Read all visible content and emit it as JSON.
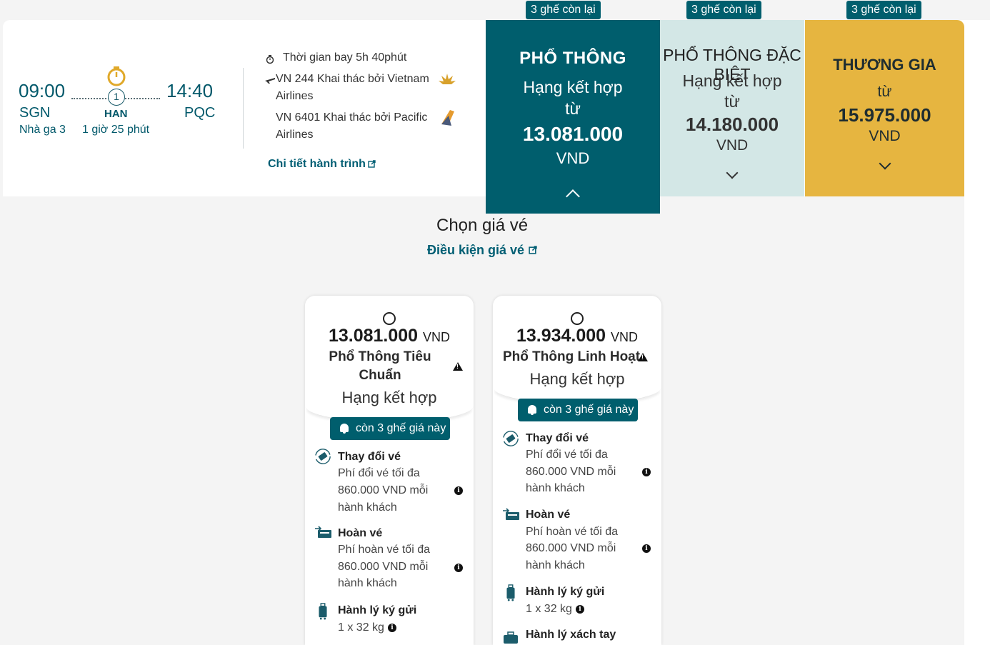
{
  "flight": {
    "depart_time": "09:00",
    "depart_code": "SGN",
    "depart_terminal": "Nhà ga 3",
    "stop_count": "1",
    "stop_code": "HAN",
    "stop_duration": "1 giờ 25 phút",
    "arrive_time": "14:40",
    "arrive_code": "PQC",
    "duration": "Thời gian bay 5h 40phút",
    "seg1_line1": "VN 244 Khai thác bởi Vietnam",
    "seg1_line2": "Airlines",
    "seg2_line1": "VN 6401 Khai thác bởi Pacific",
    "seg2_line2": "Airlines",
    "details_link": "Chi tiết hành trình"
  },
  "classes": [
    {
      "badge": "3 ghế còn lại",
      "name": "PHỔ THÔNG",
      "sub1": "Hạng kết hợp",
      "sub2": "từ",
      "price": "13.081.000",
      "currency": "VND"
    },
    {
      "badge": "3 ghế còn lại",
      "name": "PHỔ THÔNG ĐẶC BIỆT",
      "sub1": "Hạng kết hợp",
      "sub2": "từ",
      "price": "14.180.000",
      "currency": "VND"
    },
    {
      "badge": "3 ghế còn lại",
      "name": "THƯƠNG GIA",
      "sub2": "từ",
      "price": "15.975.000",
      "currency": "VND"
    }
  ],
  "fare_section": {
    "title": "Chọn giá vé",
    "conditions_link": "Điều kiện giá vé"
  },
  "fares": [
    {
      "price": "13.081.000",
      "currency": "VND",
      "name_line1": "Phổ Thông Tiêu",
      "name_line2": "Chuẩn",
      "cabin": "Hạng kết hợp",
      "seats_left": "còn 3 ghế giá này",
      "change_title": "Thay đổi vé",
      "change_l1": "Phí đổi vé tối đa",
      "change_l2": "860.000 VND mỗi",
      "change_l3": "hành khách",
      "refund_title": "Hoàn vé",
      "refund_l1": "Phí hoàn vé tối đa",
      "refund_l2": "860.000 VND mỗi",
      "refund_l3": "hành khách",
      "checked_title": "Hành lý ký gửi",
      "checked_desc": "1 x 32 kg"
    },
    {
      "price": "13.934.000",
      "currency": "VND",
      "name_line1": "Phổ Thông Linh Hoạt",
      "cabin": "Hạng kết hợp",
      "seats_left": "còn 3 ghế giá này",
      "change_title": "Thay đổi vé",
      "change_l1": "Phí đổi vé tối đa",
      "change_l2": "860.000 VND mỗi",
      "change_l3": "hành khách",
      "refund_title": "Hoàn vé",
      "refund_l1": "Phí hoàn vé tối đa",
      "refund_l2": "860.000 VND mỗi",
      "refund_l3": "hành khách",
      "checked_title": "Hành lý ký gửi",
      "checked_desc": "1 x 32 kg",
      "cabin_bag_title": "Hành lý xách tay"
    }
  ],
  "colors": {
    "brand": "#005e6d",
    "premium": "#d3e7e6",
    "business": "#e6b540"
  }
}
